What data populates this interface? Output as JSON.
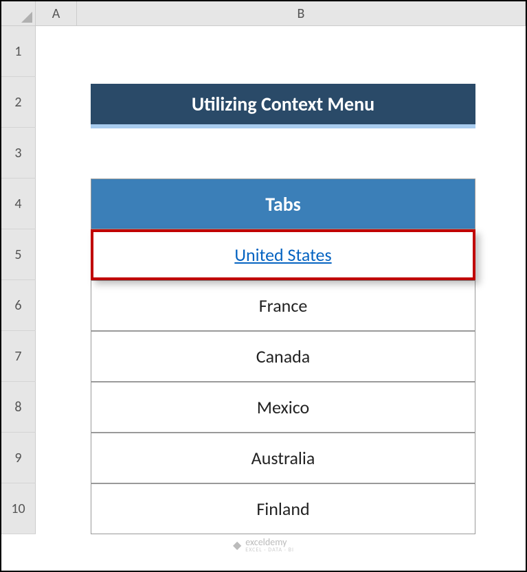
{
  "columns": [
    "A",
    "B"
  ],
  "rows": [
    "1",
    "2",
    "3",
    "4",
    "5",
    "6",
    "7",
    "8",
    "9",
    "10"
  ],
  "title": "Utilizing Context Menu",
  "table": {
    "header": "Tabs",
    "items": [
      {
        "name": "United States",
        "hyperlink": true,
        "highlighted": true
      },
      {
        "name": "France",
        "hyperlink": false,
        "highlighted": false
      },
      {
        "name": "Canada",
        "hyperlink": false,
        "highlighted": false
      },
      {
        "name": "Mexico",
        "hyperlink": false,
        "highlighted": false
      },
      {
        "name": "Australia",
        "hyperlink": false,
        "highlighted": false
      },
      {
        "name": "Finland",
        "hyperlink": false,
        "highlighted": false
      }
    ]
  },
  "watermark": {
    "text": "exceldemy",
    "sub": "EXCEL · DATA · BI"
  }
}
